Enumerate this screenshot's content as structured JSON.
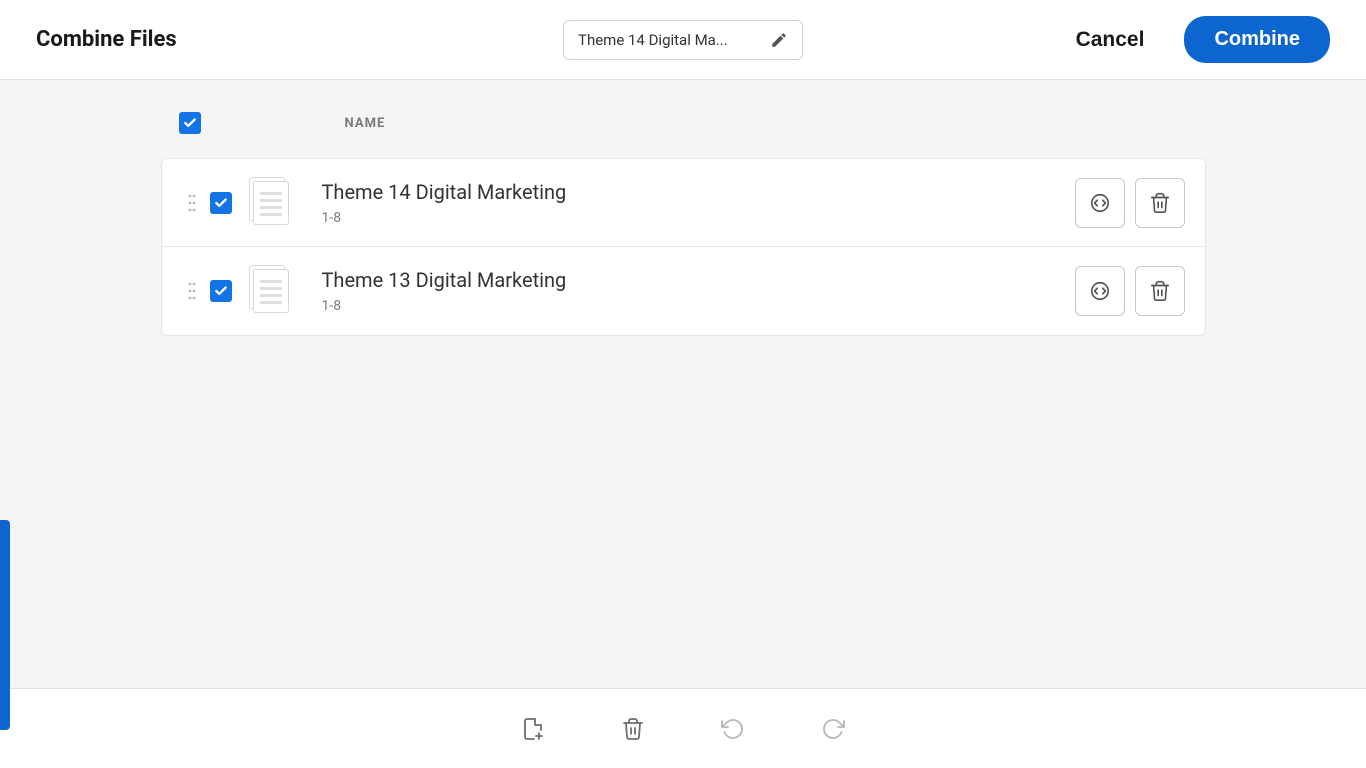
{
  "header": {
    "title": "Combine Files",
    "filename_display": "Theme 14 Digital Ma...",
    "cancel_label": "Cancel",
    "combine_label": "Combine"
  },
  "table": {
    "name_header": "NAME",
    "select_all_checked": true
  },
  "files": [
    {
      "name": "Theme 14 Digital Marketing",
      "pages": "1-8",
      "checked": true
    },
    {
      "name": "Theme 13 Digital Marketing",
      "pages": "1-8",
      "checked": true
    }
  ],
  "toolbar": {
    "add_file": "Add File",
    "delete": "Delete",
    "undo": "Undo",
    "redo": "Redo"
  },
  "colors": {
    "accent": "#1473e6"
  }
}
